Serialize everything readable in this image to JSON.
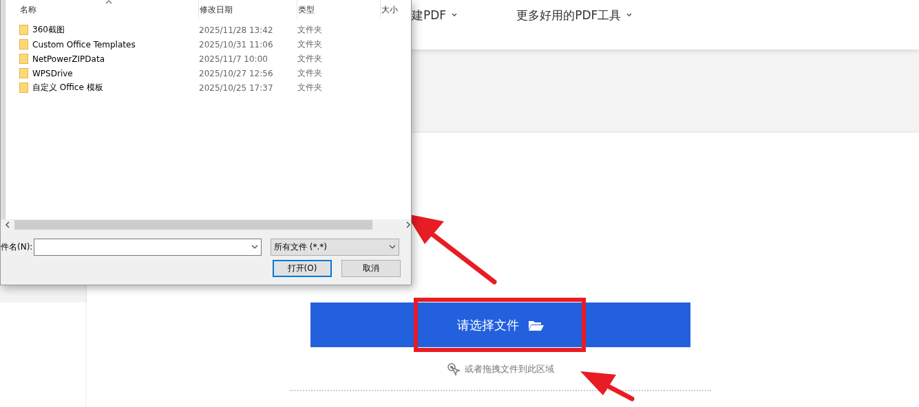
{
  "nav": {
    "items": [
      {
        "label": "建PDF"
      },
      {
        "label": "更多好用的PDF工具"
      }
    ]
  },
  "upload": {
    "button": "请选择文件",
    "hint": "或者拖拽文件到此区域"
  },
  "dialog": {
    "columns": [
      {
        "label": "名称",
        "sorted": true
      },
      {
        "label": "修改日期",
        "sorted": false
      },
      {
        "label": "类型",
        "sorted": false
      },
      {
        "label": "大小",
        "sorted": false
      }
    ],
    "rows": [
      {
        "name": "360截图",
        "modified": "2025/11/28 13:42",
        "type": "文件夹"
      },
      {
        "name": "Custom Office Templates",
        "modified": "2025/10/31 11:06",
        "type": "文件夹"
      },
      {
        "name": "NetPowerZIPData",
        "modified": "2025/11/7 10:00",
        "type": "文件夹"
      },
      {
        "name": "WPSDrive",
        "modified": "2025/10/27 12:56",
        "type": "文件夹"
      },
      {
        "name": "自定义 Office 模板",
        "modified": "2025/10/25 17:37",
        "type": "文件夹"
      }
    ],
    "filename_label": "件名(N):",
    "filetype": "所有文件 (*.*)",
    "buttons": [
      {
        "label": "打开(O)",
        "default": true
      },
      {
        "label": "取消",
        "default": false
      }
    ]
  }
}
